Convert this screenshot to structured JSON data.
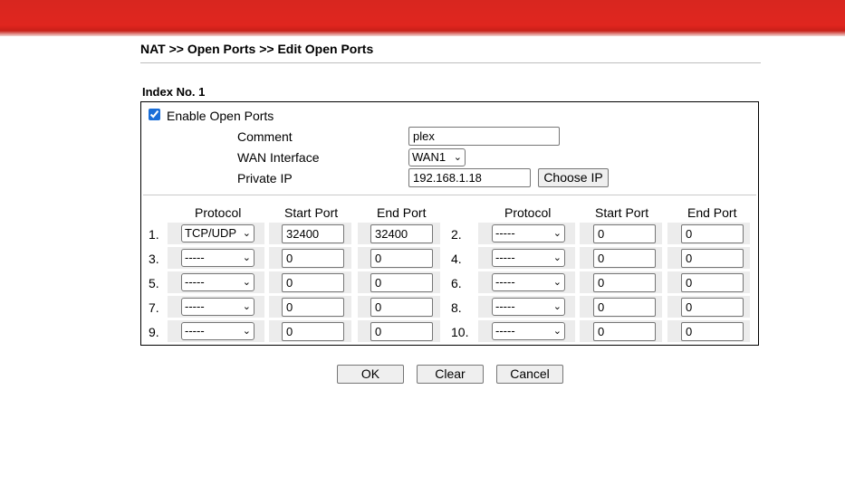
{
  "breadcrumb": "NAT >> Open Ports >> Edit Open Ports",
  "index_label": "Index No. 1",
  "enable": {
    "label": "Enable Open Ports",
    "checked": true
  },
  "comment": {
    "label": "Comment",
    "value": "plex"
  },
  "wan": {
    "label": "WAN Interface",
    "value": "WAN1"
  },
  "private_ip": {
    "label": "Private IP",
    "value": "192.168.1.18",
    "button": "Choose IP"
  },
  "headers": {
    "protocol": "Protocol",
    "start_port": "Start Port",
    "end_port": "End Port"
  },
  "entries": [
    {
      "num": "1.",
      "protocol": "TCP/UDP",
      "start": "32400",
      "end": "32400"
    },
    {
      "num": "2.",
      "protocol": "-----",
      "start": "0",
      "end": "0"
    },
    {
      "num": "3.",
      "protocol": "-----",
      "start": "0",
      "end": "0"
    },
    {
      "num": "4.",
      "protocol": "-----",
      "start": "0",
      "end": "0"
    },
    {
      "num": "5.",
      "protocol": "-----",
      "start": "0",
      "end": "0"
    },
    {
      "num": "6.",
      "protocol": "-----",
      "start": "0",
      "end": "0"
    },
    {
      "num": "7.",
      "protocol": "-----",
      "start": "0",
      "end": "0"
    },
    {
      "num": "8.",
      "protocol": "-----",
      "start": "0",
      "end": "0"
    },
    {
      "num": "9.",
      "protocol": "-----",
      "start": "0",
      "end": "0"
    },
    {
      "num": "10.",
      "protocol": "-----",
      "start": "0",
      "end": "0"
    }
  ],
  "buttons": {
    "ok": "OK",
    "clear": "Clear",
    "cancel": "Cancel"
  },
  "colors": {
    "banner": "#e0261f",
    "row_bg": "#ececec",
    "checkbox": "#1a6ed8"
  }
}
